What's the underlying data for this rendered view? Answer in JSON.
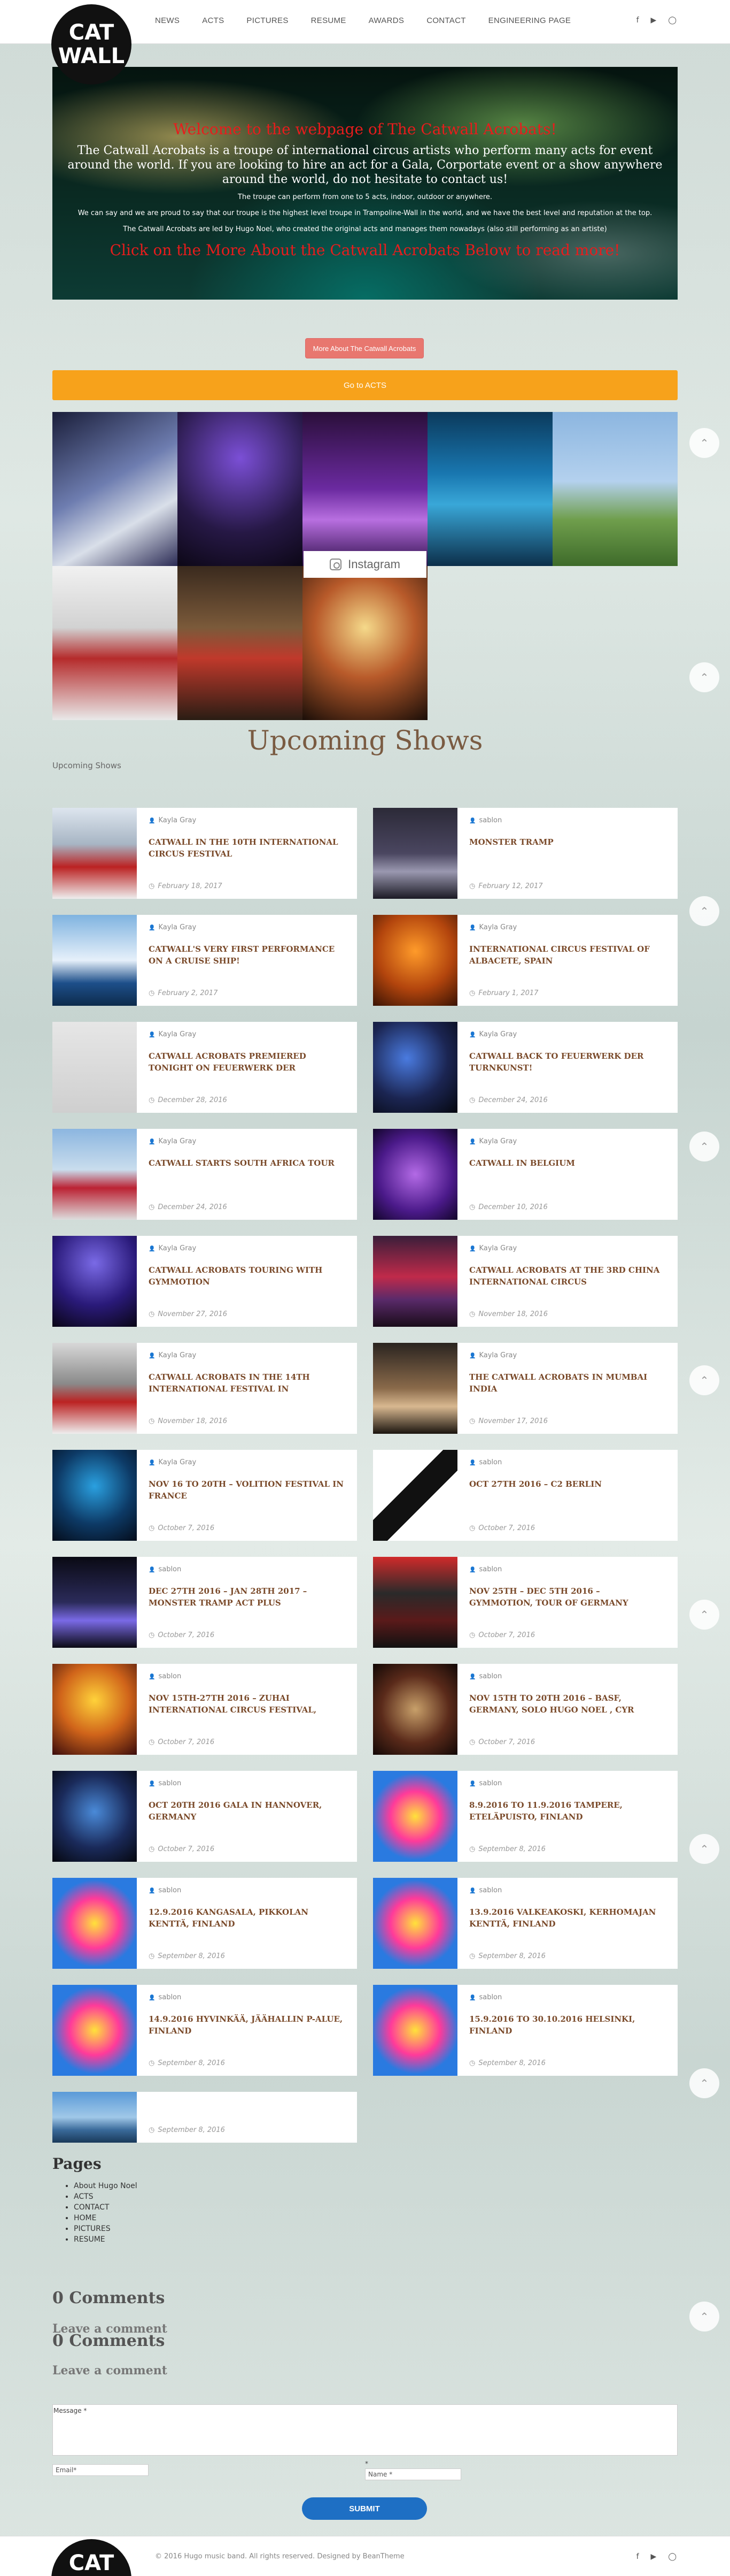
{
  "header": {
    "logo_line1": "CAT",
    "logo_line2": "WALL",
    "nav": [
      "NEWS",
      "ACTS",
      "PICTURES",
      "RESUME",
      "AWARDS",
      "CONTACT",
      "ENGINEERING PAGE"
    ],
    "social_icons": [
      "facebook-icon",
      "youtube-icon",
      "instagram-icon"
    ]
  },
  "hero": {
    "title": "Welcome to the webpage of The Catwall Acrobats!",
    "lead": "The Catwall Acrobats is a troupe of international circus artists who perform many acts for event around the world. If you are looking to hire an act for a Gala, Corportate event or a show anywhere around the world, do not hesitate to contact us!",
    "line1": "The troupe can perform from one to 5 acts, indoor, outdoor or anywhere.",
    "line2": "We can say and we are proud to say that our troupe is the highest level troupe in Trampoline-Wall in the world, and we have the best level and reputation at the top.",
    "line3": "The Catwall Acrobats are led by Hugo Noel, who created the original acts and manages them nowadays (also still performing as an artiste)",
    "cta": "Click on the More About the Catwall Acrobats Below to read more!"
  },
  "buttons": {
    "about": "More About The Catwall Acrobats",
    "acts": "Go to ACTS"
  },
  "instagram": {
    "label": "Instagram"
  },
  "shows": {
    "title": "Upcoming Shows",
    "subtitle": "Upcoming Shows",
    "posts": [
      {
        "author": "Kayla Gray",
        "title": "CATWALL IN THE 10TH INTERNATIONAL CIRCUS FESTIVAL",
        "date": "February 18, 2017"
      },
      {
        "author": "sablon",
        "title": "MONSTER TRAMP",
        "date": "February 12, 2017"
      },
      {
        "author": "Kayla Gray",
        "title": "CATWALL'S VERY FIRST PERFORMANCE ON A CRUISE SHIP!",
        "date": "February 2, 2017"
      },
      {
        "author": "Kayla Gray",
        "title": "INTERNATIONAL CIRCUS FESTIVAL OF ALBACETE, SPAIN",
        "date": "February 1, 2017"
      },
      {
        "author": "Kayla Gray",
        "title": "CATWALL ACROBATS PREMIERED TONIGHT ON FEUERWERK DER",
        "date": "December 28, 2016"
      },
      {
        "author": "Kayla Gray",
        "title": "CATWALL BACK TO FEUERWERK DER TURNKUNST!",
        "date": "December 24, 2016"
      },
      {
        "author": "Kayla Gray",
        "title": "CATWALL STARTS SOUTH AFRICA TOUR",
        "date": "December 24, 2016"
      },
      {
        "author": "Kayla Gray",
        "title": "CATWALL IN BELGIUM",
        "date": "December 10, 2016"
      },
      {
        "author": "Kayla Gray",
        "title": "CATWALL ACROBATS TOURING WITH GYMMOTION",
        "date": "November 27, 2016"
      },
      {
        "author": "Kayla Gray",
        "title": "CATWALL ACROBATS AT THE 3RD CHINA INTERNATIONAL CIRCUS",
        "date": "November 18, 2016"
      },
      {
        "author": "Kayla Gray",
        "title": "CATWALL ACROBATS IN THE 14TH INTERNATIONAL FESTIVAL IN",
        "date": "November 18, 2016"
      },
      {
        "author": "Kayla Gray",
        "title": "THE CATWALL ACROBATS IN MUMBAI INDIA",
        "date": "November 17, 2016"
      },
      {
        "author": "Kayla Gray",
        "title": "NOV 16 TO 20TH – VOLITION FESTIVAL IN FRANCE",
        "date": "October 7, 2016"
      },
      {
        "author": "sablon",
        "title": "OCT 27TH 2016 – C2 BERLIN",
        "date": "October 7, 2016"
      },
      {
        "author": "sablon",
        "title": "DEC 27TH 2016 – JAN 28TH 2017 – MONSTER TRAMP ACT PLUS",
        "date": "October 7, 2016"
      },
      {
        "author": "sablon",
        "title": "NOV 25TH – DEC 5TH 2016 – GYMMOTION, TOUR OF GERMANY",
        "date": "October 7, 2016"
      },
      {
        "author": "sablon",
        "title": "NOV 15TH-27TH 2016 – ZUHAI INTERNATIONAL CIRCUS FESTIVAL,",
        "date": "October 7, 2016"
      },
      {
        "author": "sablon",
        "title": "NOV 15TH TO 20TH 2016 – BASF, GERMANY, SOLO HUGO NOEL , CYR",
        "date": "October 7, 2016"
      },
      {
        "author": "sablon",
        "title": "OCT 20TH 2016 GALA IN HANNOVER, GERMANY",
        "date": "October 7, 2016"
      },
      {
        "author": "sablon",
        "title": "8.9.2016 TO 11.9.2016 TAMPERE, ETELÄPUISTO, FINLAND",
        "date": "September 8, 2016"
      },
      {
        "author": "sablon",
        "title": "12.9.2016 KANGASALA, PIKKOLAN KENTTÄ, FINLAND",
        "date": "September 8, 2016"
      },
      {
        "author": "sablon",
        "title": "13.9.2016 VALKEAKOSKI, KERHOMAJAN KENTTÄ, FINLAND",
        "date": "September 8, 2016"
      },
      {
        "author": "sablon",
        "title": "14.9.2016 HYVINKÄÄ, JÄÄHALLIN P-ALUE, FINLAND",
        "date": "September 8, 2016"
      },
      {
        "author": "sablon",
        "title": "15.9.2016 TO 30.10.2016 HELSINKI, FINLAND",
        "date": "September 8, 2016"
      },
      {
        "author": "",
        "title": "",
        "date": "September 8, 2016"
      }
    ]
  },
  "pages": {
    "title": "Pages",
    "items": [
      "About Hugo Noel",
      "ACTS",
      "CONTACT",
      "HOME",
      "PICTURES",
      "RESUME"
    ]
  },
  "comments": {
    "count_label": "0 Comments",
    "leave_label": "Leave a comment",
    "message_label": "Message *",
    "email_label": "Email*",
    "name_star": "*",
    "name_label": "Name *",
    "submit": "SUBMIT"
  },
  "footer": {
    "logo": "CAT",
    "copyright": "© 2016 Hugo music band. All rights reserved. Designed by BeanTheme"
  }
}
